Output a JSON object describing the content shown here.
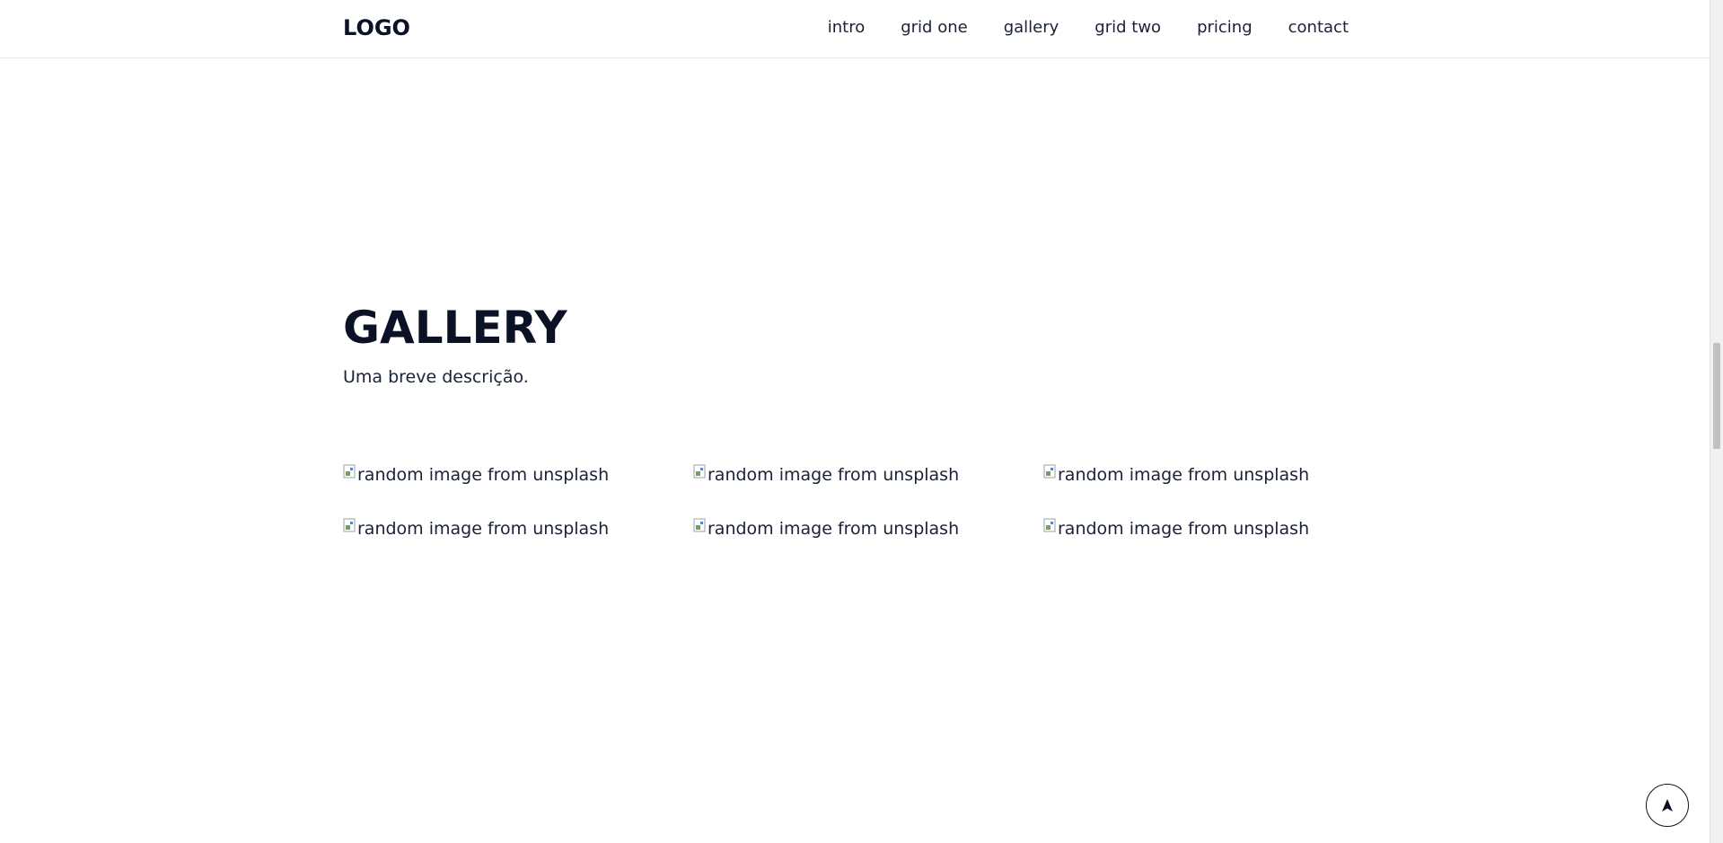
{
  "header": {
    "logo": "LOGO",
    "nav": [
      {
        "label": "intro"
      },
      {
        "label": "grid one"
      },
      {
        "label": "gallery"
      },
      {
        "label": "grid two"
      },
      {
        "label": "pricing"
      },
      {
        "label": "contact"
      }
    ]
  },
  "gallery": {
    "title": "GALLERY",
    "description": "Uma breve descrição.",
    "images": [
      {
        "alt": "random image from unsplash",
        "icon": "broken-image-icon"
      },
      {
        "alt": "random image from unsplash",
        "icon": "broken-image-icon"
      },
      {
        "alt": "random image from unsplash",
        "icon": "broken-image-icon"
      },
      {
        "alt": "random image from unsplash",
        "icon": "broken-image-icon"
      },
      {
        "alt": "random image from unsplash",
        "icon": "broken-image-icon"
      },
      {
        "alt": "random image from unsplash",
        "icon": "broken-image-icon"
      }
    ]
  },
  "back_to_top": {
    "icon": "arrow-up-icon"
  },
  "colors": {
    "text": "#0b1226",
    "background": "#ffffff",
    "border": "#e6e8ee"
  }
}
